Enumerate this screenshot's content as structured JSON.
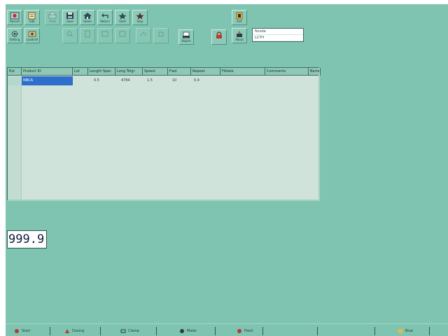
{
  "toolbar": {
    "top_row": [
      {
        "name": "record-button",
        "label": "Record",
        "icon": "record-icon"
      },
      {
        "name": "edit-button",
        "label": "Edit",
        "icon": "edit-icon"
      },
      {
        "name": "print-button",
        "label": "Print",
        "icon": "print-icon"
      },
      {
        "name": "save-button",
        "label": "Save",
        "icon": "save-icon"
      },
      {
        "name": "home-button",
        "label": "Home",
        "icon": "home-icon"
      },
      {
        "name": "return-button",
        "label": "Return",
        "icon": "return-icon"
      },
      {
        "name": "start-button",
        "label": "Start",
        "icon": "start-icon"
      },
      {
        "name": "stop-button",
        "label": "Stop",
        "icon": "stop-icon"
      },
      {
        "name": "exit-button",
        "label": "Exit",
        "icon": "exit-icon"
      }
    ],
    "second_row": [
      {
        "name": "settings-button",
        "label": "Setting",
        "icon": "gear-icon"
      },
      {
        "name": "loadcell-button",
        "label": "Loadcell",
        "icon": "loadcell-icon"
      },
      {
        "name": "report-button",
        "label": "Report",
        "icon": "report-icon"
      },
      {
        "name": "lock-button",
        "label": "",
        "icon": "lock-icon"
      },
      {
        "name": "about-button",
        "label": "About",
        "icon": "info-icon"
      }
    ],
    "combo": {
      "line1": "Ncode",
      "line2": "LCYH"
    }
  },
  "grid": {
    "columns": [
      "Ext",
      "Product ID",
      "Lot",
      "Lenght Spec",
      "Long Tolgr",
      "Speed",
      "Fwd",
      "Repeat",
      "Fildate",
      "Comments",
      "Barre"
    ],
    "row": {
      "product_id": "NBCA",
      "lot": "",
      "lenght": "0.5",
      "long_tol": "4784",
      "speed": "1.5",
      "fwd": "10",
      "repeat": "0.4",
      "fildate": "",
      "comments": "",
      "barre": ""
    }
  },
  "readout": {
    "value": "999.9"
  },
  "statusbar": {
    "items": [
      {
        "name": "status-start",
        "label": "Start",
        "icon": "start-icon"
      },
      {
        "name": "status-dosing",
        "label": "Dosing",
        "icon": "dosing-icon"
      },
      {
        "name": "status-clamp",
        "label": "Clamp",
        "icon": "clamp-icon"
      },
      {
        "name": "status-mode",
        "label": "Mode",
        "icon": "mode-icon"
      },
      {
        "name": "status-feed",
        "label": "Feed",
        "icon": "feed-icon"
      },
      {
        "name": "status-empty-1",
        "label": "",
        "icon": ""
      },
      {
        "name": "status-empty-2",
        "label": "",
        "icon": ""
      },
      {
        "name": "status-blue",
        "label": "Blue",
        "icon": "blue-icon"
      }
    ]
  },
  "colors": {
    "background": "#7fc4b0",
    "grid_bg": "#cfe3da",
    "selection": "#2e6fcc"
  }
}
